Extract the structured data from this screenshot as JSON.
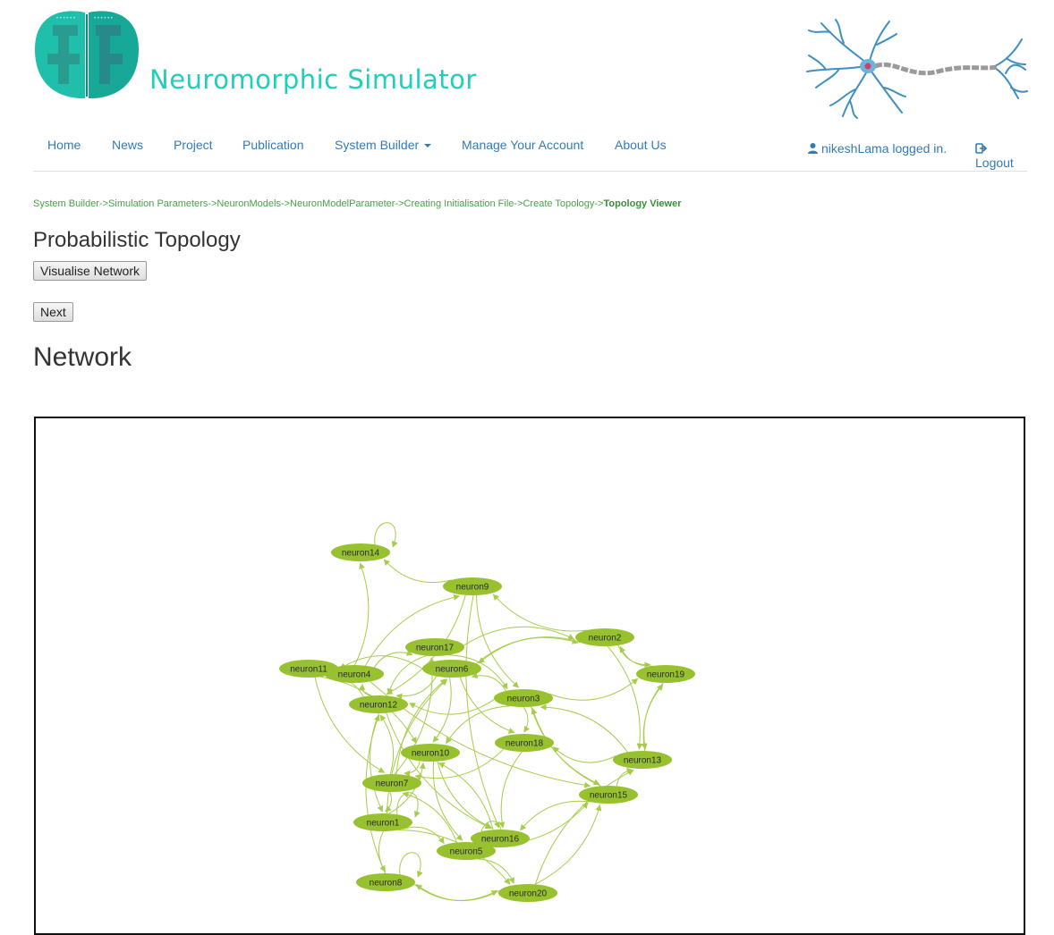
{
  "header": {
    "site_title": "Neuromorphic Simulator"
  },
  "nav": {
    "items": [
      {
        "label": "Home"
      },
      {
        "label": "News"
      },
      {
        "label": "Project"
      },
      {
        "label": "Publication"
      },
      {
        "label": "System Builder"
      },
      {
        "label": "Manage Your Account"
      },
      {
        "label": "About Us"
      }
    ],
    "user_text": "nikeshLama logged in.",
    "logout_label": "Logout"
  },
  "breadcrumb": {
    "path": "System Builder->Simulation Parameters->NeuronModels->NeuronModelParameter->Creating Initialisation File->Create Topology->",
    "current": "Topology Viewer"
  },
  "page": {
    "heading": "Probabilistic Topology",
    "visualise_button": "Visualise Network",
    "next_button": "Next",
    "network_heading": "Network"
  },
  "colors": {
    "node": "#97c12f",
    "edge": "#a6cc4b",
    "link": "#337ab7",
    "accent": "#1fcfb9",
    "breadcrumb": "#4a9f4a"
  },
  "graph": {
    "nodes": [
      "neuron1",
      "neuron2",
      "neuron3",
      "neuron4",
      "neuron5",
      "neuron6",
      "neuron7",
      "neuron8",
      "neuron9",
      "neuron10",
      "neuron11",
      "neuron12",
      "neuron13",
      "neuron14",
      "neuron15",
      "neuron16",
      "neuron17",
      "neuron18",
      "neuron19",
      "neuron20"
    ],
    "edges": [
      [
        "neuron9",
        "neuron14"
      ],
      [
        "neuron9",
        "neuron3"
      ],
      [
        "neuron9",
        "neuron12"
      ],
      [
        "neuron9",
        "neuron16"
      ],
      [
        "neuron2",
        "neuron9"
      ],
      [
        "neuron2",
        "neuron19"
      ],
      [
        "neuron2",
        "neuron13"
      ],
      [
        "neuron2",
        "neuron6"
      ],
      [
        "neuron19",
        "neuron2"
      ],
      [
        "neuron19",
        "neuron13"
      ],
      [
        "neuron13",
        "neuron19"
      ],
      [
        "neuron3",
        "neuron19"
      ],
      [
        "neuron6",
        "neuron2"
      ],
      [
        "neuron6",
        "neuron11"
      ],
      [
        "neuron6",
        "neuron10"
      ],
      [
        "neuron6",
        "neuron18"
      ],
      [
        "neuron6",
        "neuron12"
      ],
      [
        "neuron3",
        "neuron6"
      ],
      [
        "neuron17",
        "neuron2"
      ],
      [
        "neuron17",
        "neuron12"
      ],
      [
        "neuron17",
        "neuron3"
      ],
      [
        "neuron4",
        "neuron14"
      ],
      [
        "neuron4",
        "neuron17"
      ],
      [
        "neuron4",
        "neuron15"
      ],
      [
        "neuron4",
        "neuron9"
      ],
      [
        "neuron12",
        "neuron11"
      ],
      [
        "neuron12",
        "neuron4"
      ],
      [
        "neuron12",
        "neuron16"
      ],
      [
        "neuron3",
        "neuron12"
      ],
      [
        "neuron3",
        "neuron10"
      ],
      [
        "neuron3",
        "neuron18"
      ],
      [
        "neuron3",
        "neuron15"
      ],
      [
        "neuron18",
        "neuron7"
      ],
      [
        "neuron18",
        "neuron16"
      ],
      [
        "neuron13",
        "neuron18"
      ],
      [
        "neuron13",
        "neuron3"
      ],
      [
        "neuron15",
        "neuron13"
      ],
      [
        "neuron15",
        "neuron16"
      ],
      [
        "neuron15",
        "neuron3"
      ],
      [
        "neuron10",
        "neuron5"
      ],
      [
        "neuron10",
        "neuron7"
      ],
      [
        "neuron10",
        "neuron16"
      ],
      [
        "neuron7",
        "neuron6"
      ],
      [
        "neuron7",
        "neuron17"
      ],
      [
        "neuron7",
        "neuron1"
      ],
      [
        "neuron7",
        "neuron12"
      ],
      [
        "neuron1",
        "neuron6"
      ],
      [
        "neuron1",
        "neuron10"
      ],
      [
        "neuron1",
        "neuron5"
      ],
      [
        "neuron1",
        "neuron8"
      ],
      [
        "neuron1",
        "neuron20"
      ],
      [
        "neuron5",
        "neuron7"
      ],
      [
        "neuron5",
        "neuron20"
      ],
      [
        "neuron5",
        "neuron15"
      ],
      [
        "neuron16",
        "neuron5"
      ],
      [
        "neuron16",
        "neuron10"
      ],
      [
        "neuron20",
        "neuron8"
      ],
      [
        "neuron20",
        "neuron15"
      ],
      [
        "neuron20",
        "neuron13"
      ],
      [
        "neuron8",
        "neuron20"
      ],
      [
        "neuron8",
        "neuron12"
      ],
      [
        "neuron11",
        "neuron7"
      ],
      [
        "neuron11",
        "neuron10"
      ],
      [
        "neuron14",
        "neuron14"
      ],
      [
        "neuron8",
        "neuron8"
      ],
      [
        "neuron5",
        "neuron5"
      ],
      [
        "neuron1",
        "neuron1"
      ],
      [
        "neuron12",
        "neuron1"
      ]
    ]
  }
}
